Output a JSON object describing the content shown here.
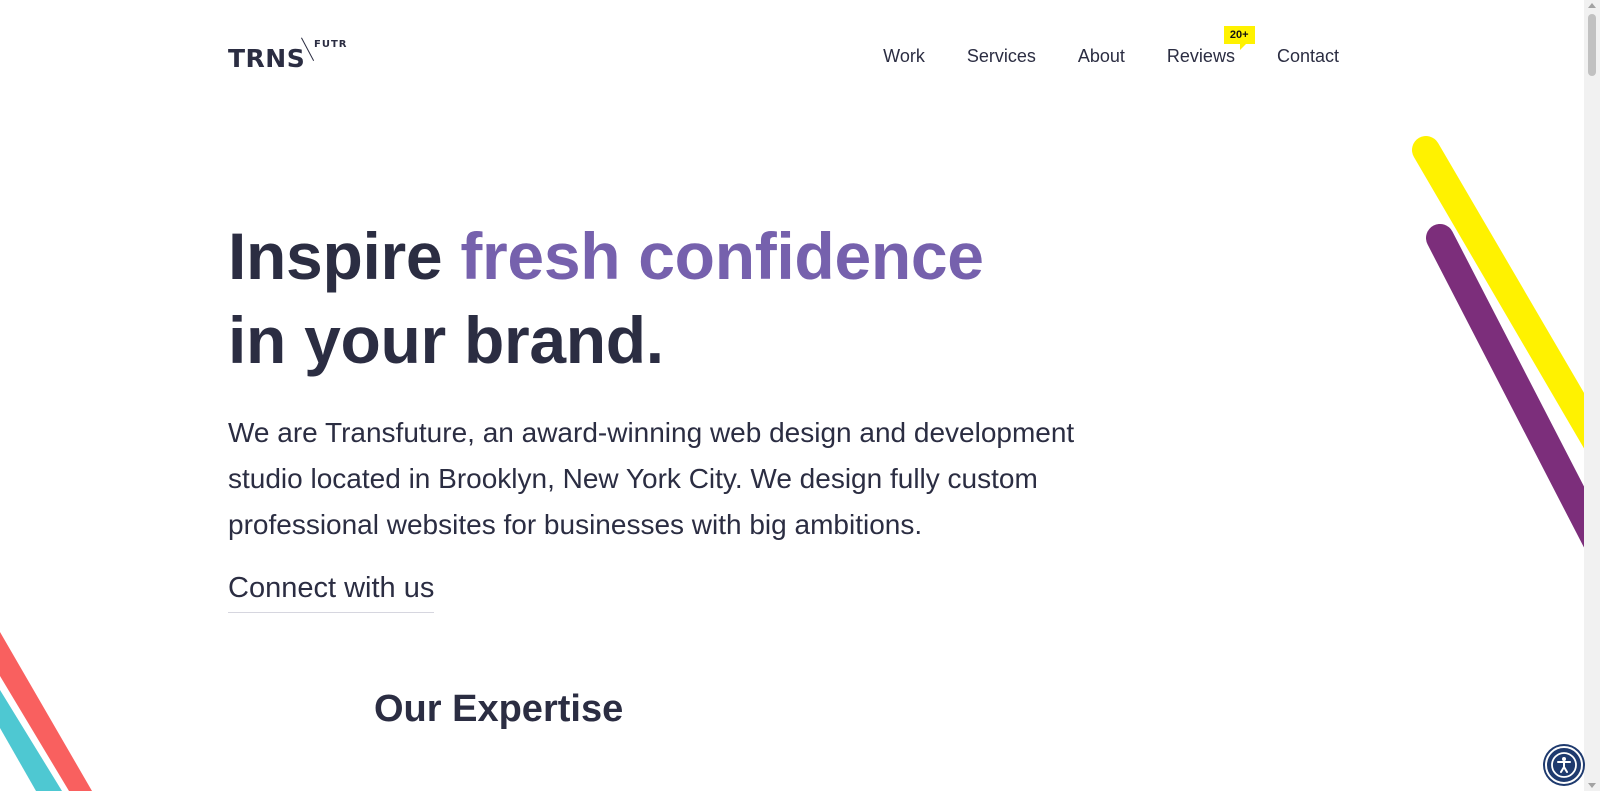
{
  "brand": {
    "logo_main": "TRNS",
    "logo_sub": "FUTR"
  },
  "nav": {
    "items": [
      {
        "label": "Work"
      },
      {
        "label": "Services"
      },
      {
        "label": "About"
      },
      {
        "label": "Reviews",
        "badge": "20+"
      },
      {
        "label": "Contact"
      }
    ]
  },
  "hero": {
    "headline_start": "Inspire ",
    "headline_accent": "fresh confidence",
    "headline_end": "in your brand.",
    "intro": "We are Transfuture, an award-winning web design and development studio located in Brooklyn, New York City. We design fully custom professional websites for businesses with big ambitions.",
    "cta": "Connect with us"
  },
  "expertise": {
    "title": "Our Expertise"
  },
  "colors": {
    "text": "#2b2d42",
    "accent": "#7661ad",
    "yellow": "#fff200",
    "purple": "#7c2e7b",
    "coral": "#f9605f",
    "teal": "#4ec8d2",
    "a11y_button": "#1e3a6e"
  },
  "icons": {
    "accessibility": "accessibility-icon"
  }
}
